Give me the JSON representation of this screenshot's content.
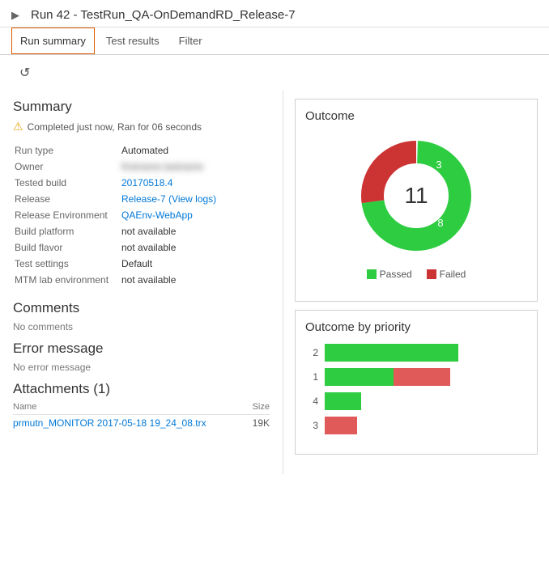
{
  "header": {
    "title": "Run 42 - TestRun_QA-OnDemandRD_Release-7"
  },
  "tabs": [
    {
      "label": "Run summary",
      "active": true
    },
    {
      "label": "Test results",
      "active": false
    },
    {
      "label": "Filter",
      "active": false
    }
  ],
  "refresh_button": "↺",
  "summary": {
    "section_title": "Summary",
    "warning": "Completed just now, Ran for 06 seconds",
    "fields": [
      {
        "label": "Run type",
        "value": "Automated",
        "type": "text"
      },
      {
        "label": "Owner",
        "value": "owner_name_blurred",
        "type": "blur"
      },
      {
        "label": "Tested build",
        "value": "20170518.4",
        "type": "link"
      },
      {
        "label": "Release",
        "value": "Release-7 (View logs)",
        "type": "link"
      },
      {
        "label": "Release Environment",
        "value": "QAEnv-WebApp",
        "type": "link"
      },
      {
        "label": "Build platform",
        "value": "not available",
        "type": "text"
      },
      {
        "label": "Build flavor",
        "value": "not available",
        "type": "text"
      },
      {
        "label": "Test settings",
        "value": "Default",
        "type": "text"
      },
      {
        "label": "MTM lab environment",
        "value": "not available",
        "type": "text"
      }
    ],
    "comments_title": "Comments",
    "comments_text": "No comments",
    "error_title": "Error message",
    "error_text": "No error message",
    "attachments_title": "Attachments (1)",
    "attachments_col_name": "Name",
    "attachments_col_size": "Size",
    "attachment_file": "prmutn_MONITOR 2017-05-18 19_24_08.trx",
    "attachment_size": "19K"
  },
  "outcome": {
    "title": "Outcome",
    "total": "11",
    "passed": 8,
    "failed": 3,
    "legend_passed": "Passed",
    "legend_failed": "Failed",
    "colors": {
      "passed": "#2ecc40",
      "failed": "#cc3333"
    }
  },
  "priority": {
    "title": "Outcome by priority",
    "rows": [
      {
        "label": "2",
        "passed_width": 165,
        "failed_width": 0
      },
      {
        "label": "1",
        "passed_width": 85,
        "failed_width": 70
      },
      {
        "label": "4",
        "passed_width": 45,
        "failed_width": 0
      },
      {
        "label": "3",
        "passed_width": 0,
        "failed_width": 40
      }
    ]
  }
}
